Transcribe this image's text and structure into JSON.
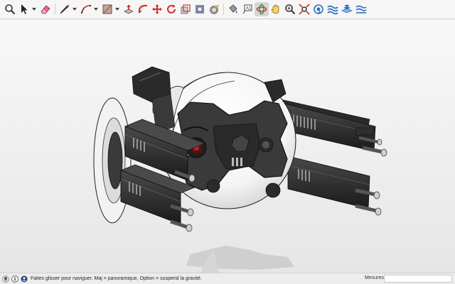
{
  "toolbar": {
    "tools": [
      {
        "name": "zoom-icon",
        "active": false
      },
      {
        "name": "select-arrow-icon",
        "active": false,
        "dropdown": true
      },
      {
        "name": "eraser-icon",
        "active": false
      },
      {
        "name": "pencil-line-icon",
        "active": false,
        "dropdown": true
      },
      {
        "name": "arc-icon",
        "active": false,
        "dropdown": true
      },
      {
        "name": "rectangle-shape-icon",
        "active": false,
        "dropdown": true
      },
      {
        "name": "push-pull-icon",
        "active": false
      },
      {
        "name": "follow-me-icon",
        "active": false
      },
      {
        "name": "move-icon",
        "active": false
      },
      {
        "name": "rotate-icon",
        "active": false
      },
      {
        "name": "scale-icon",
        "active": false
      },
      {
        "name": "offset-icon",
        "active": false
      },
      {
        "name": "tape-measure-icon",
        "active": false
      },
      {
        "name": "text-label-icon",
        "active": false
      },
      {
        "name": "orbit-icon",
        "active": true
      },
      {
        "name": "pan-hand-icon",
        "active": false
      },
      {
        "name": "zoom-window-icon",
        "active": false
      },
      {
        "name": "zoom-extents-icon",
        "active": false
      },
      {
        "name": "position-camera-icon",
        "active": false
      },
      {
        "name": "sandbox-smoove-icon",
        "active": false
      },
      {
        "name": "sandbox-stamp-icon",
        "active": false
      },
      {
        "name": "sandbox-drape-icon",
        "active": false
      }
    ],
    "colors": {
      "red": "#d6302c",
      "blue": "#2a6fc4",
      "green": "#3a8f3e",
      "dark": "#333333"
    }
  },
  "statusbar": {
    "hint": "Faites glisser pour naviguer. Maj = panoramique, Option =  suspend la gravité.",
    "measure_label": "Mesures",
    "measure_value": ""
  }
}
